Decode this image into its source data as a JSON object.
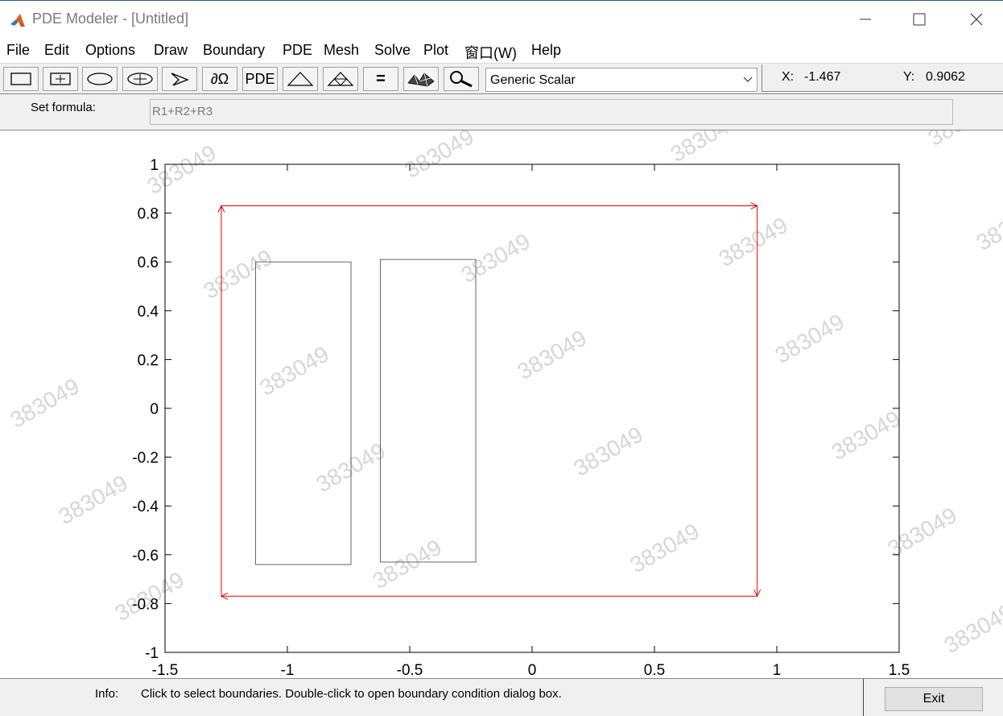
{
  "window": {
    "title": "PDE Modeler - [Untitled]",
    "controls": [
      "minimize",
      "maximize",
      "close"
    ]
  },
  "menu": [
    "File",
    "Edit",
    "Options",
    "Draw",
    "Boundary",
    "PDE",
    "Mesh",
    "Solve",
    "Plot",
    "窗口(W)",
    "Help"
  ],
  "toolbar": {
    "buttons": [
      {
        "name": "rectangle-icon"
      },
      {
        "name": "centered-rectangle-icon"
      },
      {
        "name": "ellipse-icon"
      },
      {
        "name": "centered-ellipse-icon"
      },
      {
        "name": "polygon-icon"
      },
      {
        "name": "boundary-mode-icon",
        "label": "∂Ω"
      },
      {
        "name": "pde-specification-button",
        "label": "PDE"
      },
      {
        "name": "init-mesh-icon"
      },
      {
        "name": "refine-mesh-icon"
      },
      {
        "name": "solve-icon",
        "label": "="
      },
      {
        "name": "plot-solution-icon"
      },
      {
        "name": "zoom-icon"
      }
    ],
    "application_mode": "Generic Scalar"
  },
  "coords": {
    "x_label": "X:",
    "x_value": "-1.467",
    "y_label": "Y:",
    "y_value": "0.9062"
  },
  "formula": {
    "label": "Set formula:",
    "value": "R1+R2+R3"
  },
  "plot": {
    "xticks": [
      "-1.5",
      "-1",
      "-0.5",
      "0",
      "0.5",
      "1",
      "1.5"
    ],
    "yticks": [
      "1",
      "0.8",
      "0.6",
      "0.4",
      "0.2",
      "0",
      "-0.2",
      "-0.4",
      "-0.6",
      "-0.8",
      "-1"
    ],
    "xlim": [
      -1.5,
      1.5
    ],
    "ylim": [
      -1,
      1
    ],
    "boundary_color": "#e00000",
    "outer_boundary": {
      "x1": -1.27,
      "x2": 0.92,
      "y1": -0.77,
      "y2": 0.83
    },
    "inner_rects": [
      {
        "x1": -1.13,
        "x2": -0.74,
        "y1": -0.64,
        "y2": 0.6
      },
      {
        "x1": -0.62,
        "x2": -0.23,
        "y1": -0.63,
        "y2": 0.61
      }
    ],
    "watermark": "383049"
  },
  "status": {
    "info_label": "Info:",
    "info_text": "Click to select boundaries. Double-click to open boundary condition dialog box.",
    "exit_label": "Exit"
  }
}
